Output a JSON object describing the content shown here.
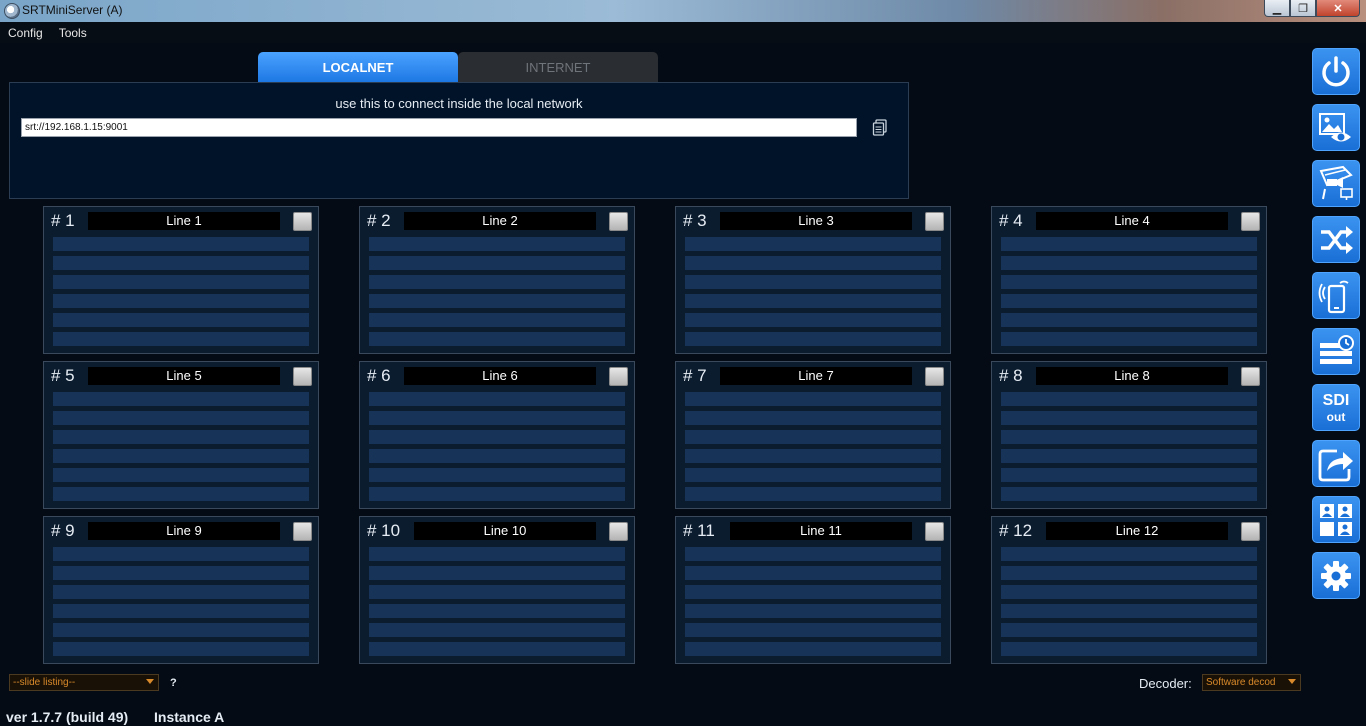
{
  "window": {
    "title": "SRTMiniServer (A)",
    "min": "▁",
    "max": "❐",
    "close": "✕"
  },
  "menu": [
    "Config",
    "Tools"
  ],
  "tabs": {
    "active": "LOCALNET",
    "inactive": "INTERNET"
  },
  "connect": {
    "hint": "use this to connect inside the local network",
    "url": "srt://192.168.1.15:9001",
    "copy_icon": "copy-icon"
  },
  "lines": [
    {
      "num": "# 1",
      "name": "Line 1"
    },
    {
      "num": "# 2",
      "name": "Line 2"
    },
    {
      "num": "# 3",
      "name": "Line 3"
    },
    {
      "num": "# 4",
      "name": "Line 4"
    },
    {
      "num": "# 5",
      "name": "Line 5"
    },
    {
      "num": "# 6",
      "name": "Line 6"
    },
    {
      "num": "# 7",
      "name": "Line 7"
    },
    {
      "num": "# 8",
      "name": "Line 8"
    },
    {
      "num": "# 9",
      "name": "Line 9"
    },
    {
      "num": "# 10",
      "name": "Line 10"
    },
    {
      "num": "# 11",
      "name": "Line 11"
    },
    {
      "num": "# 12",
      "name": "Line 12"
    }
  ],
  "toolbar": [
    {
      "icon": "power-icon"
    },
    {
      "icon": "image-preview-icon"
    },
    {
      "icon": "camera-network-icon"
    },
    {
      "icon": "shuffle-icon"
    },
    {
      "icon": "mobile-icon"
    },
    {
      "icon": "schedule-icon"
    },
    {
      "icon": "sdi-out-icon",
      "label_top": "SDI",
      "label_bottom": "out"
    },
    {
      "icon": "share-icon"
    },
    {
      "icon": "users-icon"
    },
    {
      "icon": "settings-icon"
    }
  ],
  "bottom": {
    "slide_listing": "--slide listing--",
    "help": "?",
    "decoder_label": "Decoder:",
    "decoder_value": "Software decod",
    "version": "ver 1.7.7 (build 49)",
    "instance": "Instance A"
  },
  "colors": {
    "background": "#040b14",
    "accent_blue": "#1e78e4",
    "panel": "#0c1c2f",
    "slot": "#173357",
    "dropdown_text": "#d98a2a"
  }
}
